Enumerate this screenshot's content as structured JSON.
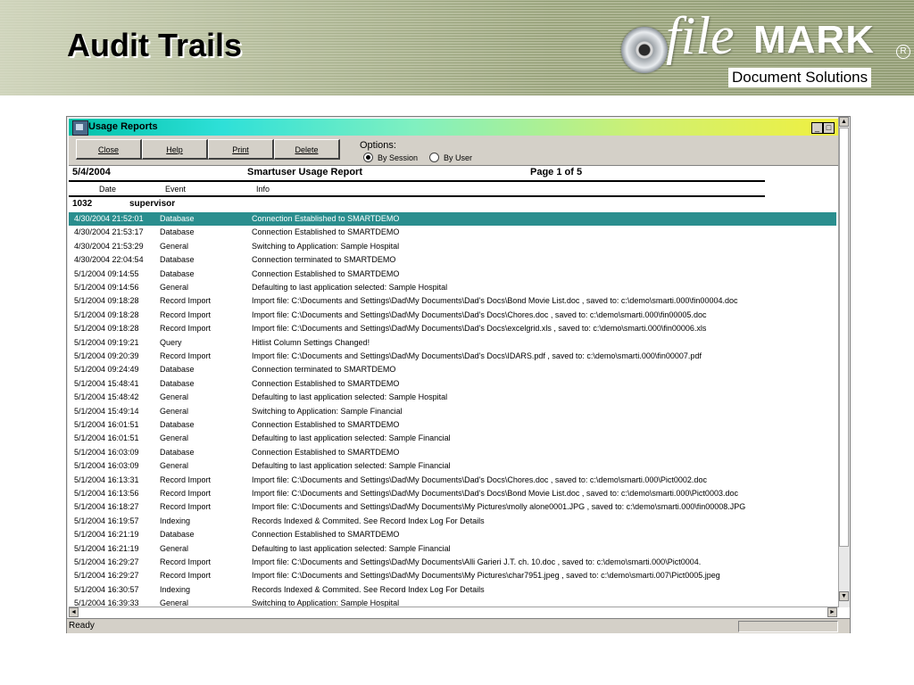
{
  "slide": {
    "title": "Audit Trails",
    "logo_file": "file",
    "logo_mark": "MARK",
    "logo_reg": "R",
    "logo_sub": "Document Solutions"
  },
  "window": {
    "title": "Usage Reports",
    "min_glyph": "_",
    "max_glyph": "□",
    "buttons": {
      "close": "Close",
      "help": "Help",
      "print": "Print",
      "delete": "Delete"
    },
    "options": {
      "label": "Options:",
      "by_session": "By Session",
      "by_user": "By User",
      "selected": "By Session"
    }
  },
  "report": {
    "date": "5/4/2004",
    "title": "Smartuser Usage Report",
    "page": "Page 1 of 5",
    "columns": [
      "Date",
      "Event",
      "Info"
    ],
    "group_id": "1032",
    "group_user": "supervisor",
    "rows": [
      {
        "date": "4/30/2004 21:52:01",
        "event": "Database",
        "info": "Connection Established to SMARTDEMO",
        "selected": true
      },
      {
        "date": "4/30/2004 21:53:17",
        "event": "Database",
        "info": "Connection Established to SMARTDEMO"
      },
      {
        "date": "4/30/2004 21:53:29",
        "event": "General",
        "info": "Switching to Application: Sample Hospital"
      },
      {
        "date": "4/30/2004 22:04:54",
        "event": "Database",
        "info": "Connection terminated to SMARTDEMO"
      },
      {
        "date": "5/1/2004 09:14:55",
        "event": "Database",
        "info": "Connection Established to SMARTDEMO"
      },
      {
        "date": "5/1/2004 09:14:56",
        "event": "General",
        "info": "Defaulting to last application selected: Sample Hospital"
      },
      {
        "date": "5/1/2004 09:18:28",
        "event": "Record Import",
        "info": "Import file: C:\\Documents and Settings\\Dad\\My Documents\\Dad's Docs\\Bond Movie List.doc , saved to: c:\\demo\\smarti.000\\fin00004.doc"
      },
      {
        "date": "5/1/2004 09:18:28",
        "event": "Record Import",
        "info": "Import file: C:\\Documents and Settings\\Dad\\My Documents\\Dad's Docs\\Chores.doc , saved to: c:\\demo\\smarti.000\\fin00005.doc"
      },
      {
        "date": "5/1/2004 09:18:28",
        "event": "Record Import",
        "info": "Import file: C:\\Documents and Settings\\Dad\\My Documents\\Dad's Docs\\excelgrid.xls , saved to: c:\\demo\\smarti.000\\fin00006.xls"
      },
      {
        "date": "5/1/2004 09:19:21",
        "event": "Query",
        "info": "Hitlist Column Settings Changed!"
      },
      {
        "date": "5/1/2004 09:20:39",
        "event": "Record Import",
        "info": "Import file: C:\\Documents and Settings\\Dad\\My Documents\\Dad's Docs\\IDARS.pdf , saved to: c:\\demo\\smarti.000\\fin00007.pdf"
      },
      {
        "date": "5/1/2004 09:24:49",
        "event": "Database",
        "info": "Connection terminated to SMARTDEMO"
      },
      {
        "date": "5/1/2004 15:48:41",
        "event": "Database",
        "info": "Connection Established to SMARTDEMO"
      },
      {
        "date": "5/1/2004 15:48:42",
        "event": "General",
        "info": "Defaulting to last application selected: Sample Hospital"
      },
      {
        "date": "5/1/2004 15:49:14",
        "event": "General",
        "info": "Switching to Application: Sample Financial"
      },
      {
        "date": "5/1/2004 16:01:51",
        "event": "Database",
        "info": "Connection Established to SMARTDEMO"
      },
      {
        "date": "5/1/2004 16:01:51",
        "event": "General",
        "info": "Defaulting to last application selected: Sample Financial"
      },
      {
        "date": "5/1/2004 16:03:09",
        "event": "Database",
        "info": "Connection Established to SMARTDEMO"
      },
      {
        "date": "5/1/2004 16:03:09",
        "event": "General",
        "info": "Defaulting to last application selected: Sample Financial"
      },
      {
        "date": "5/1/2004 16:13:31",
        "event": "Record Import",
        "info": "Import file: C:\\Documents and Settings\\Dad\\My Documents\\Dad's Docs\\Chores.doc , saved to: c:\\demo\\smarti.000\\Pict0002.doc"
      },
      {
        "date": "5/1/2004 16:13:56",
        "event": "Record Import",
        "info": "Import file: C:\\Documents and Settings\\Dad\\My Documents\\Dad's Docs\\Bond Movie List.doc , saved to: c:\\demo\\smarti.000\\Pict0003.doc"
      },
      {
        "date": "5/1/2004 16:18:27",
        "event": "Record Import",
        "info": "Import file: C:\\Documents and Settings\\Dad\\My Documents\\My Pictures\\molly alone0001.JPG , saved to: c:\\demo\\smarti.000\\fin00008.JPG"
      },
      {
        "date": "5/1/2004 16:19:57",
        "event": "Indexing",
        "info": "Records Indexed & Commited.  See Record Index Log For Details"
      },
      {
        "date": "5/1/2004 16:21:19",
        "event": "Database",
        "info": "Connection Established to SMARTDEMO"
      },
      {
        "date": "5/1/2004 16:21:19",
        "event": "General",
        "info": "Defaulting to last application selected: Sample Financial"
      },
      {
        "date": "5/1/2004 16:29:27",
        "event": "Record Import",
        "info": "Import file: C:\\Documents and Settings\\Dad\\My Documents\\Alli Garieri J.T. ch. 10.doc , saved to: c:\\demo\\smarti.000\\Pict0004."
      },
      {
        "date": "5/1/2004 16:29:27",
        "event": "Record Import",
        "info": "Import file: C:\\Documents and Settings\\Dad\\My Documents\\My Pictures\\char7951.jpeg , saved to: c:\\demo\\smarti.007\\Pict0005.jpeg"
      },
      {
        "date": "5/1/2004 16:30:57",
        "event": "Indexing",
        "info": "Records Indexed & Commited.  See Record Index Log For Details"
      },
      {
        "date": "5/1/2004 16:39:33",
        "event": "General",
        "info": "Switching to Application: Sample Hospital"
      }
    ]
  },
  "status": {
    "text": "Ready"
  },
  "colors": {
    "selected_row": "#2a8e8e",
    "chrome": "#d4d0c8"
  }
}
